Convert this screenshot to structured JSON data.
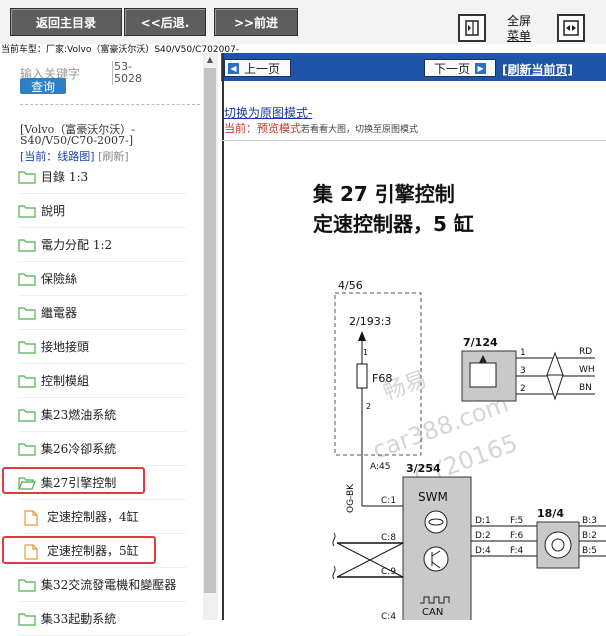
{
  "toolbar": {
    "home_label": "返回主目录",
    "back_label": "<<后退.",
    "forward_label": ">>前进",
    "fullscreen_label_line1": "全屏",
    "fullscreen_label_line2": "菜单"
  },
  "header": {
    "car_model": "当前车型：厂家:Volvo（富豪沃尔沃）S40/V50/C702007-"
  },
  "sidebar": {
    "keyword_label": "输入关键字",
    "search_button": "查询",
    "code_line1": "53-",
    "code_line2": "5028",
    "vehicle_name": "[Volvo（富豪沃尔沃）-S40/V50/C70-2007-]",
    "current_label": "[当前：线路图]",
    "refresh_label": "[刷新]",
    "items": [
      {
        "label": "目錄 1:3",
        "type": "folder"
      },
      {
        "label": "說明",
        "type": "folder"
      },
      {
        "label": "電力分配 1:2",
        "type": "folder"
      },
      {
        "label": "保險絲",
        "type": "folder"
      },
      {
        "label": "繼電器",
        "type": "folder"
      },
      {
        "label": "接地接頭",
        "type": "folder"
      },
      {
        "label": "控制模組",
        "type": "folder"
      },
      {
        "label": "集23燃油系統",
        "type": "folder"
      },
      {
        "label": "集26冷卻系統",
        "type": "folder"
      },
      {
        "label": "集27引擎控制",
        "type": "folder-open"
      },
      {
        "label": "定速控制器，4缸",
        "type": "file"
      },
      {
        "label": "定速控制器，5缸",
        "type": "file"
      },
      {
        "label": "集32交流發電機和變壓器",
        "type": "folder"
      },
      {
        "label": "集33起動系統",
        "type": "folder"
      }
    ]
  },
  "main": {
    "prev_page": "上一页",
    "next_page": "下一页",
    "refresh_current": "[刷新当前页]",
    "switch_mode": "切换为原图模式-",
    "mode_prefix": "当前：",
    "mode_name": "预览模式",
    "mode_hint": "若看看大图，切换至原图模式"
  },
  "diagram": {
    "title_line1": "集 27 引擎控制",
    "title_line2": "定速控制器，5 缸",
    "labels": {
      "box_ref": "4/56",
      "fuse_ref": "2/193:3",
      "fuse_name": "F68",
      "pin1": "1",
      "pin2": "2",
      "a45": "A:45",
      "wire_color": "OG-BK",
      "swm_ref": "3/254",
      "swm_name": "SWM",
      "c1": "C:1",
      "c8": "C:8",
      "c9": "C:9",
      "can": "CAN",
      "c4": "C:4",
      "d1": "D:1",
      "d2": "D:2",
      "d4": "D:4",
      "f5": "F:5",
      "f6": "F:6",
      "f4": "F:4",
      "sensor_ref": "7/124",
      "s1": "1",
      "s3": "3",
      "s2": "2",
      "rd": "RD",
      "wh": "WH",
      "bn": "BN",
      "switch_ref": "18/4",
      "b3": "B:3",
      "b2": "B:2",
      "b5": "B:5"
    },
    "watermark": [
      "畅易",
      "car388.com",
      "CY20165"
    ]
  },
  "colors": {
    "toolbar_button": "#5e5e5e",
    "main_bar": "#1f55a6",
    "highlight": "#e0393e",
    "link": "#1b36a8"
  }
}
